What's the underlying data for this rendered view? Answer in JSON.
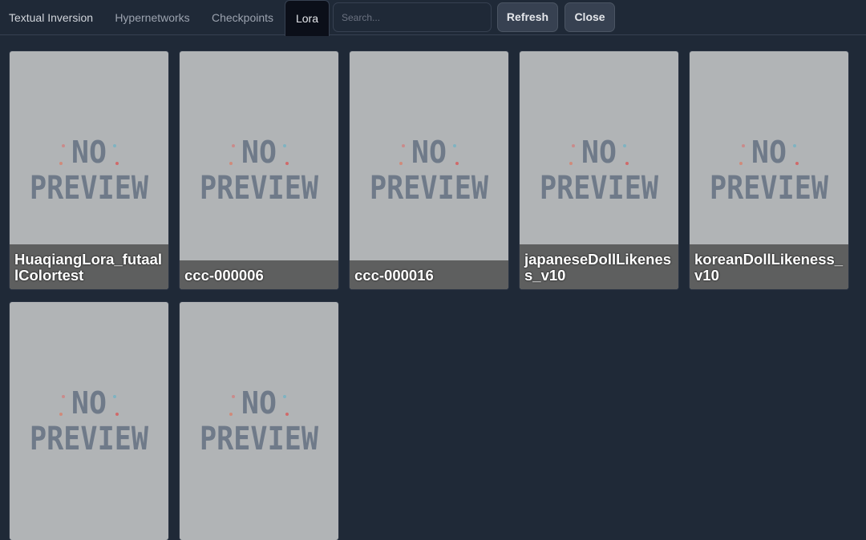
{
  "tabs": [
    {
      "label": "Textual Inversion",
      "selected": false
    },
    {
      "label": "Hypernetworks",
      "selected": false
    },
    {
      "label": "Checkpoints",
      "selected": false
    },
    {
      "label": "Lora",
      "selected": true
    }
  ],
  "search": {
    "placeholder": "Search...",
    "value": ""
  },
  "buttons": {
    "refresh": "Refresh",
    "close": "Close"
  },
  "preview_text": {
    "line1": "NO",
    "line2": "PREVIEW"
  },
  "cards": [
    {
      "name": "HuaqiangLora_futaallColortest"
    },
    {
      "name": "ccc-000006"
    },
    {
      "name": "ccc-000016"
    },
    {
      "name": "japaneseDollLikeness_v10"
    },
    {
      "name": "koreanDollLikeness_v10"
    },
    {
      "name": ""
    },
    {
      "name": ""
    }
  ],
  "colors": {
    "background": "#1f2937",
    "card": "#b1b4b6",
    "preview_text": "#6f7a89",
    "caption_bg": "#464646"
  }
}
